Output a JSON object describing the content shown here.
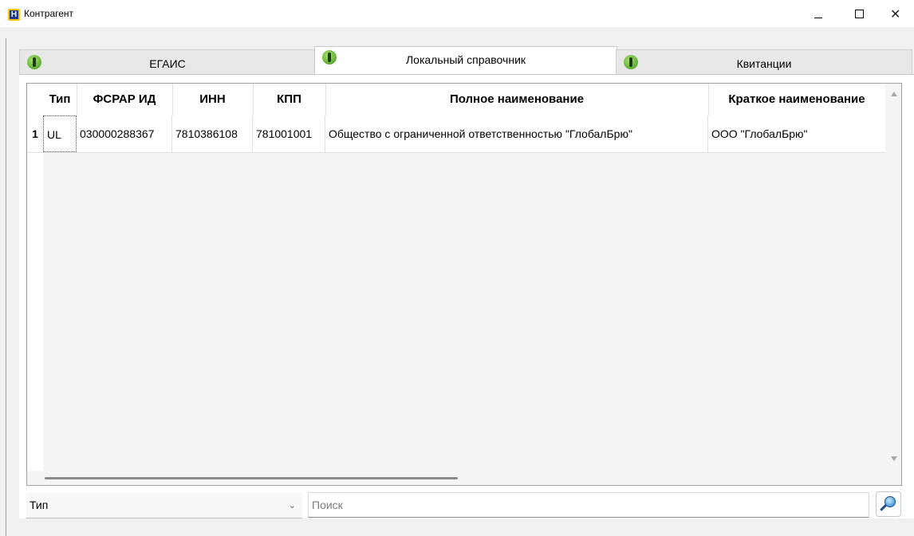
{
  "window": {
    "title": "Контрагент",
    "app_icon_letter": "H",
    "controls": {
      "minimize": "—",
      "maximize": "□",
      "close": "✕"
    }
  },
  "tabs": [
    {
      "label": "ЕГАИС",
      "icon": "person-icon",
      "active": false
    },
    {
      "label": "Локальный справочник",
      "icon": "person-icon",
      "active": true
    },
    {
      "label": "Квитанции",
      "icon": "person-icon",
      "active": false
    }
  ],
  "table": {
    "columns": [
      "Тип",
      "ФСРАР ИД",
      "ИНН",
      "КПП",
      "Полное наименование",
      "Краткое наименование"
    ],
    "rows": [
      {
        "num": "1",
        "cells": [
          "UL",
          "030000288367",
          "7810386108",
          "781001001",
          "Общество с ограниченной ответственностью \"ГлобалБрю\"",
          "ООО \"ГлобалБрю\""
        ]
      }
    ]
  },
  "filter": {
    "value": "Тип",
    "chevron": "⌄"
  },
  "search": {
    "placeholder": "Поиск"
  },
  "colors": {
    "tab_icon": "#3f9a1e",
    "app_icon_bg": "#ffc000",
    "app_icon_fg": "#1f3a8a",
    "search_icon": "#2a7fd0"
  }
}
